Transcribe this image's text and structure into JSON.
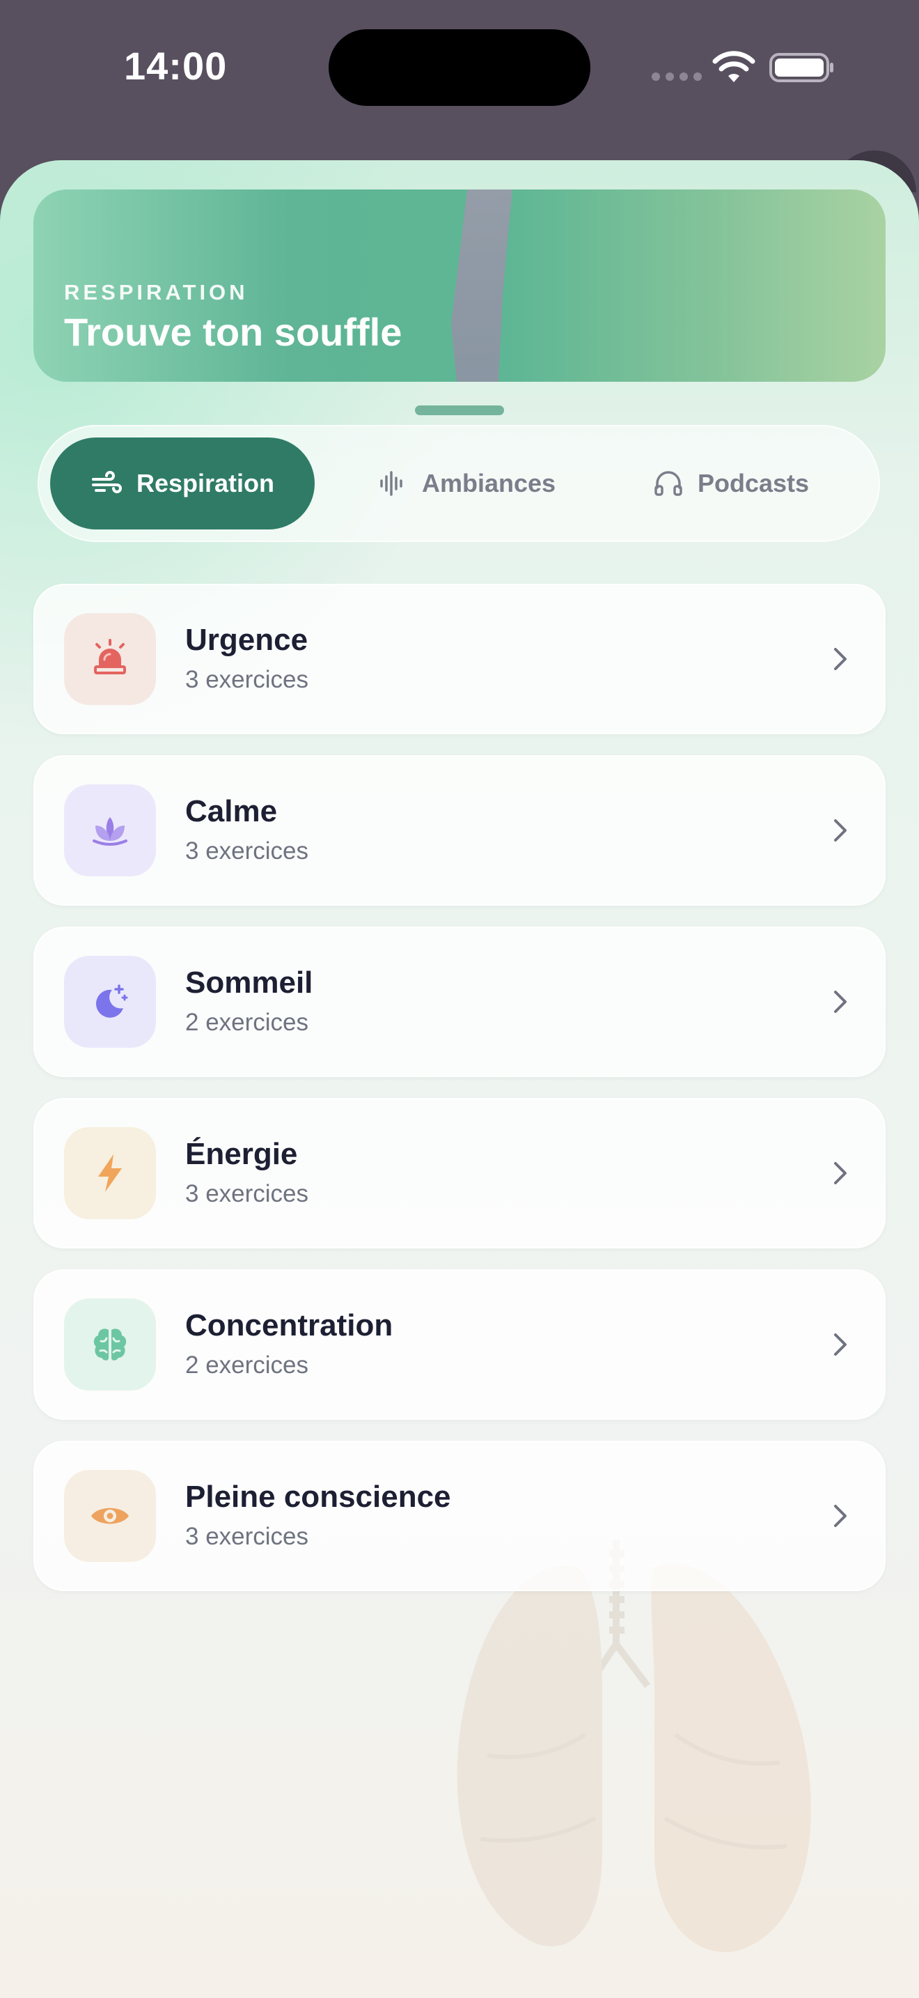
{
  "status_bar": {
    "time": "14:00"
  },
  "hero": {
    "eyebrow": "RESPIRATION",
    "title": "Trouve ton souffle"
  },
  "tabs": [
    {
      "label": "Respiration",
      "icon": "wind-icon",
      "active": true
    },
    {
      "label": "Ambiances",
      "icon": "waveform-icon",
      "active": false
    },
    {
      "label": "Podcasts",
      "icon": "headphones-icon",
      "active": false
    }
  ],
  "categories": [
    {
      "title": "Urgence",
      "subtitle": "3 exercices",
      "icon": "siren-icon",
      "icon_color": "#e4645f",
      "tile_color": "#f5e8e3"
    },
    {
      "title": "Calme",
      "subtitle": "3 exercices",
      "icon": "lotus-icon",
      "icon_color": "#9a7fe6",
      "tile_color": "#ece8fb"
    },
    {
      "title": "Sommeil",
      "subtitle": "2 exercices",
      "icon": "moon-stars-icon",
      "icon_color": "#7b74ea",
      "tile_color": "#e9e8fb"
    },
    {
      "title": "Énergie",
      "subtitle": "3 exercices",
      "icon": "bolt-icon",
      "icon_color": "#f0a55a",
      "tile_color": "#f7efdf"
    },
    {
      "title": "Concentration",
      "subtitle": "2 exercices",
      "icon": "brain-icon",
      "icon_color": "#6cc6a2",
      "tile_color": "#e3f4ec"
    },
    {
      "title": "Pleine conscience",
      "subtitle": "3 exercices",
      "icon": "eye-icon",
      "icon_color": "#eda35e",
      "tile_color": "#f6eee2"
    }
  ]
}
